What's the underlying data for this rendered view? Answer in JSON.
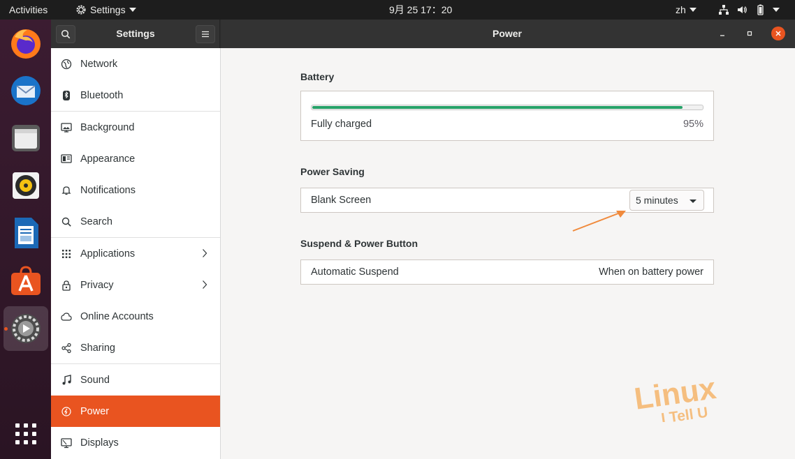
{
  "topbar": {
    "activities": "Activities",
    "app_menu": "Settings",
    "clock": "9月 25  17：20",
    "lang": "zh"
  },
  "dock": {
    "items": [
      "firefox-icon",
      "thunderbird-icon",
      "files-icon",
      "rhythmbox-icon",
      "libreoffice-writer-icon",
      "ubuntu-software-icon",
      "settings-icon",
      "show-apps-icon"
    ]
  },
  "sidebar": {
    "title": "Settings",
    "items": [
      {
        "label": "Network"
      },
      {
        "label": "Bluetooth"
      },
      {
        "label": "Background"
      },
      {
        "label": "Appearance"
      },
      {
        "label": "Notifications"
      },
      {
        "label": "Search"
      },
      {
        "label": "Applications"
      },
      {
        "label": "Privacy"
      },
      {
        "label": "Online Accounts"
      },
      {
        "label": "Sharing"
      },
      {
        "label": "Sound"
      },
      {
        "label": "Power"
      },
      {
        "label": "Displays"
      }
    ],
    "selected": "Power"
  },
  "page": {
    "title": "Power",
    "battery": {
      "section_title": "Battery",
      "status": "Fully charged",
      "percent_label": "95%",
      "level": 0.95
    },
    "power_saving": {
      "section_title": "Power Saving",
      "blank_screen_label": "Blank Screen",
      "blank_screen_value": "5 minutes"
    },
    "suspend": {
      "section_title": "Suspend & Power Button",
      "automatic_suspend_label": "Automatic Suspend",
      "automatic_suspend_value": "When on battery power"
    }
  },
  "watermark": {
    "line1": "Linux",
    "line2": "I Tell U"
  },
  "colors": {
    "accent": "#e95420",
    "battery_fill": "#26a269",
    "annotation_arrow": "#f08a3c",
    "watermark": "#f5b46a"
  }
}
